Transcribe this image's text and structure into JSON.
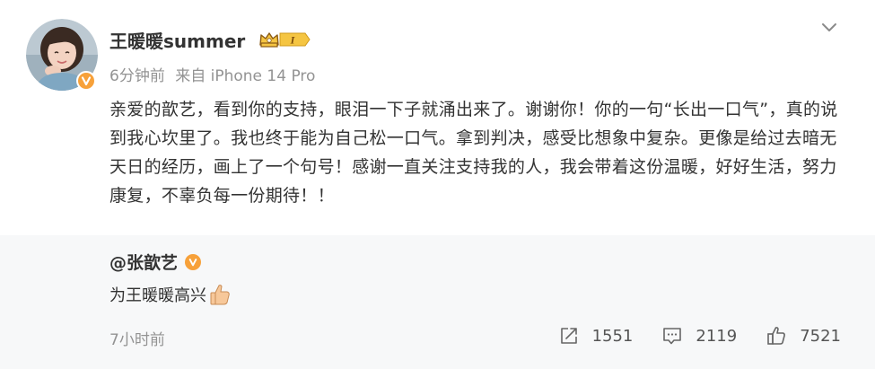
{
  "post": {
    "author": "王暖暖summer",
    "vip_level": "I",
    "time": "6分钟前",
    "source": "来自 iPhone 14 Pro",
    "text": "亲爱的歆艺，看到你的支持，眼泪一下子就涌出来了。谢谢你！你的一句“长出一口气”，真的说到我心坎里了。我也终于能为自己松一口气。拿到判决，感受比想象中复杂。更像是给过去暗无天日的经历，画上了一个句号！感谢一直关注支持我的人，我会带着这份温暖，好好生活，努力康复，不辜负每一份期待！！"
  },
  "retweet": {
    "author": "@张歆艺",
    "text": "为王暖暖高兴",
    "time": "7小时前",
    "actions": {
      "share_count": "1551",
      "comment_count": "2119",
      "like_count": "7521"
    }
  },
  "icons": {
    "more": "chevron-down-icon",
    "share": "share-icon",
    "comment": "comment-icon",
    "like": "thumbs-up-icon",
    "verified": "verified-v-icon"
  },
  "colors": {
    "verified": "#f7a13a",
    "meta_text": "#939393",
    "retweet_bg": "#f7f8f9"
  }
}
